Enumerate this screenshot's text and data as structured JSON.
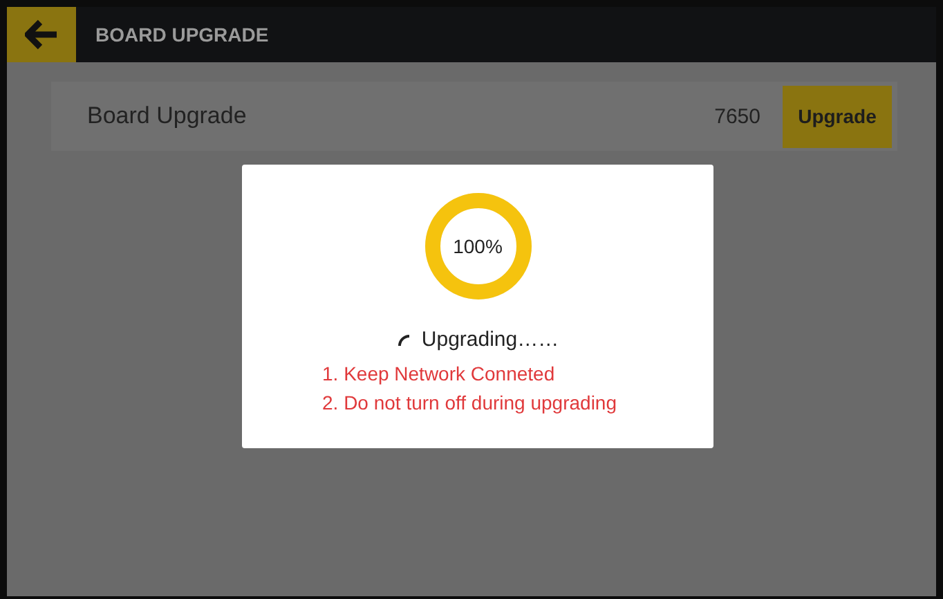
{
  "header": {
    "title": "BOARD UPGRADE"
  },
  "board_row": {
    "label": "Board Upgrade",
    "version": "7650",
    "button": "Upgrade"
  },
  "dialog": {
    "progress": {
      "level": 1,
      "reading": "100%"
    },
    "status": "Upgrading……",
    "notes": [
      "1. Keep Network Conneted",
      "2. Do not turn off during upgrading"
    ]
  }
}
